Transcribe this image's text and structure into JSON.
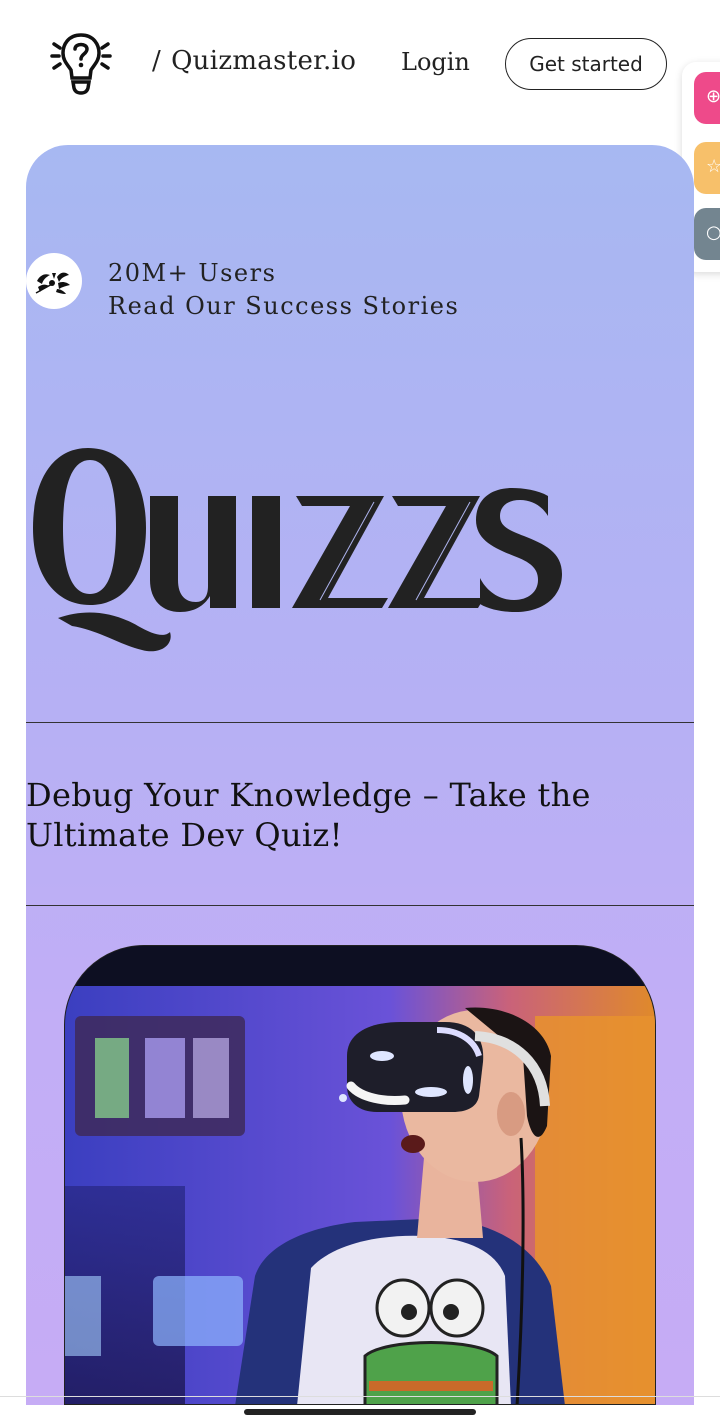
{
  "header": {
    "slash": "/",
    "brand": "Quizmaster.io",
    "login_label": "Login",
    "cta_label": "Get started"
  },
  "side_widget": {
    "buttons": [
      {
        "icon": "plus-icon",
        "color": "#ee4a8a",
        "glyph": "⊕"
      },
      {
        "icon": "star-icon",
        "color": "#f7c06a",
        "glyph": "☆"
      },
      {
        "icon": "search-icon",
        "color": "#738590",
        "glyph": "○"
      }
    ]
  },
  "hero": {
    "stats_line1": "20M+ Users",
    "stats_line2": "Read Our Success Stories",
    "wordmark": "Quizzs",
    "headline": "Debug Your Knowledge – Take the Ultimate Dev Quiz!",
    "image_alt": "Person wearing a VR headset"
  },
  "colors": {
    "gradient_top": "#a7b8f2",
    "gradient_bottom": "#c6acf5",
    "text": "#222222"
  }
}
